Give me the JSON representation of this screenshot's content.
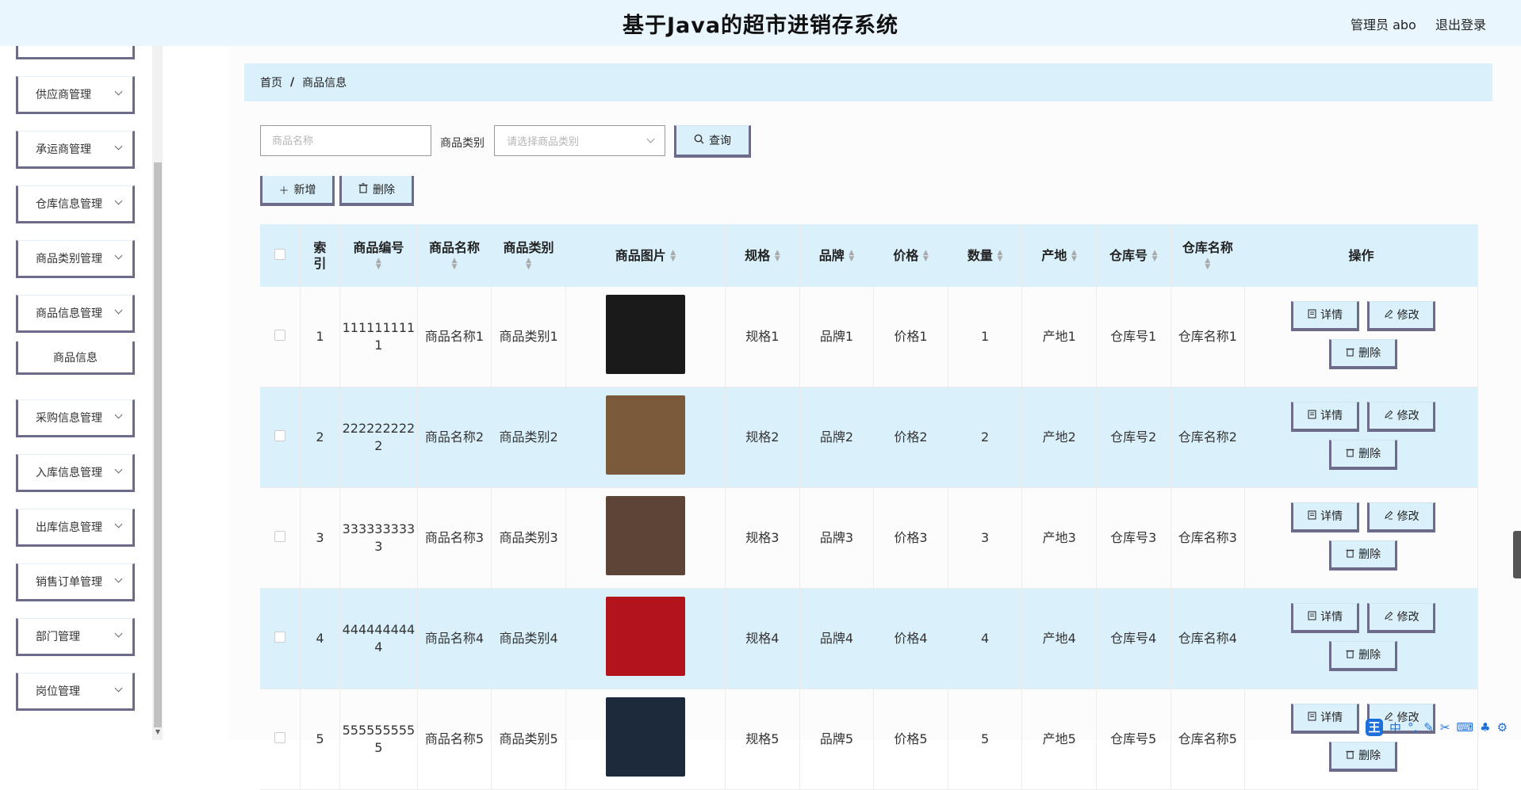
{
  "header": {
    "title": "基于Java的超市进销存系统",
    "user": "管理员 abo",
    "logout": "退出登录"
  },
  "sidebar": {
    "items": [
      {
        "label": "供应商管理"
      },
      {
        "label": "承运商管理"
      },
      {
        "label": "仓库信息管理"
      },
      {
        "label": "商品类别管理"
      },
      {
        "label": "商品信息管理"
      },
      {
        "label": "商品信息",
        "sub": true
      },
      {
        "label": "采购信息管理"
      },
      {
        "label": "入库信息管理"
      },
      {
        "label": "出库信息管理"
      },
      {
        "label": "销售订单管理"
      },
      {
        "label": "部门管理"
      },
      {
        "label": "岗位管理"
      }
    ]
  },
  "breadcrumb": {
    "home": "首页",
    "separator": "/",
    "current": "商品信息"
  },
  "search": {
    "name_placeholder": "商品名称",
    "category_label": "商品类别",
    "category_placeholder": "请选择商品类别",
    "query_label": "查询",
    "add_label": "新增",
    "delete_label": "删除"
  },
  "table": {
    "headers": {
      "index": "索引",
      "code": "商品编号",
      "name": "商品名称",
      "category": "商品类别",
      "image": "商品图片",
      "spec": "规格",
      "brand": "品牌",
      "price": "价格",
      "qty": "数量",
      "origin": "产地",
      "wh_no": "仓库号",
      "wh_name": "仓库名称",
      "ops": "操作"
    },
    "op_labels": {
      "detail": "详情",
      "edit": "修改",
      "delete": "删除"
    },
    "rows": [
      {
        "index": "1",
        "code": "1111111111",
        "name": "商品名称1",
        "category": "商品类别1",
        "spec": "规格1",
        "brand": "品牌1",
        "price": "价格1",
        "qty": "1",
        "origin": "产地1",
        "wh_no": "仓库号1",
        "wh_name": "仓库名称1",
        "image_color": "#1a1a1a"
      },
      {
        "index": "2",
        "code": "2222222222",
        "name": "商品名称2",
        "category": "商品类别2",
        "spec": "规格2",
        "brand": "品牌2",
        "price": "价格2",
        "qty": "2",
        "origin": "产地2",
        "wh_no": "仓库号2",
        "wh_name": "仓库名称2",
        "image_color": "#7a5a3a"
      },
      {
        "index": "3",
        "code": "3333333333",
        "name": "商品名称3",
        "category": "商品类别3",
        "spec": "规格3",
        "brand": "品牌3",
        "price": "价格3",
        "qty": "3",
        "origin": "产地3",
        "wh_no": "仓库号3",
        "wh_name": "仓库名称3",
        "image_color": "#5c4536"
      },
      {
        "index": "4",
        "code": "4444444444",
        "name": "商品名称4",
        "category": "商品类别4",
        "spec": "规格4",
        "brand": "品牌4",
        "price": "价格4",
        "qty": "4",
        "origin": "产地4",
        "wh_no": "仓库号4",
        "wh_name": "仓库名称4",
        "image_color": "#b3141c"
      },
      {
        "index": "5",
        "code": "5555555555",
        "name": "商品名称5",
        "category": "商品类别5",
        "spec": "规格5",
        "brand": "品牌5",
        "price": "价格5",
        "qty": "5",
        "origin": "产地5",
        "wh_no": "仓库号5",
        "wh_name": "仓库名称5",
        "image_color": "#1c2a3c"
      }
    ]
  },
  "ime": {
    "badge": "王",
    "lang": "中"
  },
  "colors": {
    "header_bg": "#e9f6fd",
    "accent_bg": "#daf1fc",
    "button_border": "#6c6c8a"
  }
}
